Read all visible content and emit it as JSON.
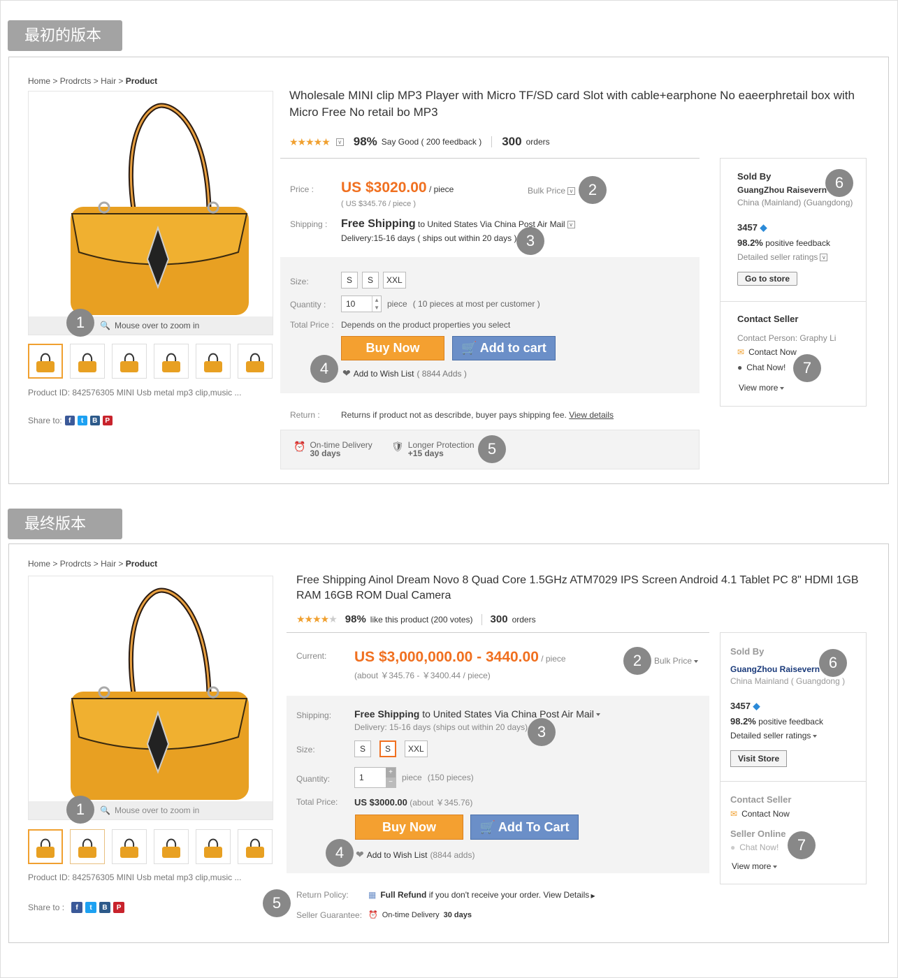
{
  "top": {
    "tag": "最初的版本",
    "breadcrumb": [
      "Home",
      "Prodrcts",
      "Hair",
      "Product"
    ],
    "title": "Wholesale MINI clip MP3 Player with Micro TF/SD card Slot with cable+earphone No eaeerphretail box with Micro Free  No retail bo MP3",
    "rating_pct": "98%",
    "rating_text": "Say Good ( 200 feedback )",
    "orders_num": "300",
    "orders_label": "orders",
    "price_label": "Price :",
    "price": "US $3020.00",
    "price_unit": "/ piece",
    "price_sub": "( US $345.76 / piece )",
    "bulk": "Bulk Price",
    "shipping_label": "Shipping :",
    "free_shipping": "Free Shipping",
    "ship_to": "to United States Via China Post Air Mail",
    "delivery": "Delivery:15-16 days ( ships out within 20 days )",
    "size_label": "Size:",
    "sizes": [
      "S",
      "S",
      "XXL"
    ],
    "qty_label": "Quantity :",
    "qty": "10",
    "qty_unit": "piece",
    "qty_note": "( 10 pieces at most per customer )",
    "total_label": "Total Price :",
    "total_text": "Depends on the product properties you select",
    "buy": "Buy Now",
    "cart": "Add to cart",
    "wish": "Add to Wish List",
    "wish_count": "( 8844 Adds )",
    "return_label": "Return :",
    "return_text": "Returns if product not as describde, buyer pays shipping fee.",
    "return_link": "View details",
    "g1_a": "On-time Delivery",
    "g1_b": "30 days",
    "g2_a": "Longer Protection",
    "g2_b": "+15 days",
    "zoom": "Mouse over to zoom in",
    "product_id": "Product ID: 842576305 MINI Usb metal mp3 clip,music ...",
    "share": "Share to:",
    "sold_by": "Sold By",
    "seller_name": "GuangZhou Raisevern",
    "seller_loc": "China (Mainland) (Guangdong)",
    "score": "3457",
    "pos_pct": "98.2%",
    "pos_text": "positive feedback",
    "detailed": "Detailed seller ratings",
    "store_btn": "Go to store",
    "contact_seller": "Contact Seller",
    "contact_person": "Contact Person: Graphy Li",
    "contact_now": "Contact Now",
    "chat_now": "Chat Now!",
    "view_more": "View more",
    "nums": [
      "1",
      "2",
      "3",
      "4",
      "5",
      "6",
      "7"
    ]
  },
  "bottom": {
    "tag": "最终版本",
    "breadcrumb": [
      "Home",
      "Prodrcts",
      "Hair",
      "Product"
    ],
    "title": "Free Shipping Ainol Dream Novo 8 Quad Core 1.5GHz ATM7029 IPS Screen Android 4.1 Tablet PC 8\" HDMI 1GB RAM 16GB ROM Dual Camera",
    "rating_pct": "98%",
    "rating_text": "like this product (200 votes)",
    "orders_num": "300",
    "orders_label": "orders",
    "price_label": "Current:",
    "price": "US $3,000,000.00 - 3440.00",
    "price_unit": "/ piece",
    "price_sub": "(about ￥345.76 - ￥3400.44 / piece)",
    "bulk": "Bulk Price",
    "shipping_label": "Shipping:",
    "free_shipping": "Free Shipping",
    "ship_to": "to United States Via China Post Air Mail",
    "delivery": "Delivery: 15-16 days (ships out within 20 days)",
    "size_label": "Size:",
    "sizes": [
      "S",
      "S",
      "XXL"
    ],
    "qty_label": "Quantity:",
    "qty": "1",
    "qty_unit": "piece",
    "qty_note": "(150 pieces)",
    "total_label": "Total Price:",
    "total_value": "US $3000.00",
    "total_about": "(about ￥345.76)",
    "buy": "Buy Now",
    "cart": "Add To Cart",
    "wish": "Add to Wish List",
    "wish_count": "(8844 adds)",
    "return_label": "Return Policy:",
    "return_bold": "Full Refund",
    "return_text": "if you don't receive your order.",
    "return_link": "View Details",
    "guarantee_label": "Seller Guarantee:",
    "guarantee_text": "On-time Delivery",
    "guarantee_days": "30 days",
    "zoom": "Mouse over to zoom in",
    "product_id": "Product ID: 842576305 MINI Usb metal mp3 clip,music ...",
    "share": "Share to :",
    "sold_by": "Sold By",
    "seller_name": "GuangZhou Raisevern",
    "seller_loc": "China Mainland ( Guangdong )",
    "score": "3457",
    "pos_pct": "98.2%",
    "pos_text": "positive feedback",
    "detailed": "Detailed seller ratings",
    "store_btn": "Visit Store",
    "contact_seller": "Contact Seller",
    "contact_now": "Contact Now",
    "seller_online": "Seller Online",
    "chat_now": "Chat Now!",
    "view_more": "View more",
    "nums": [
      "1",
      "2",
      "3",
      "4",
      "5",
      "6",
      "7"
    ]
  },
  "colors": {
    "accent": "#f07020",
    "buy": "#f4a030",
    "cart": "#6b8fc8",
    "badge": "#888888",
    "tag": "#a3a3a3"
  },
  "share_icons": [
    "facebook-icon",
    "twitter-icon",
    "blogger-icon",
    "pinterest-icon"
  ]
}
